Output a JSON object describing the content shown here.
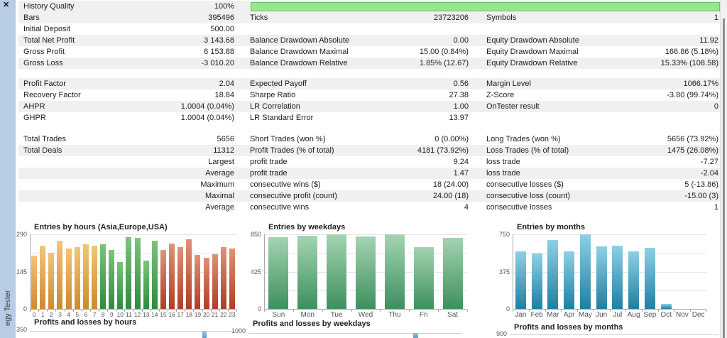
{
  "sidebar": {
    "close_glyph": "✕",
    "tab_label": "egy Tester"
  },
  "quality_bar": {
    "fill_color": "#98e78a",
    "border_color": "#6abf68"
  },
  "stats": {
    "rows": [
      {
        "l1": "History Quality",
        "v1": "100%",
        "progress": true,
        "shaded": true
      },
      {
        "l1": "Bars",
        "v1": "395496",
        "l2": "Ticks",
        "v2": "23723206",
        "l3": "Symbols",
        "v3": "1",
        "shaded": true
      },
      {
        "l1": "Initial Deposit",
        "v1": "500.00",
        "shaded": false
      },
      {
        "l1": "Total Net Profit",
        "v1": "3 143.68",
        "l2": "Balance Drawdown Absolute",
        "v2": "0.00",
        "l3": "Equity Drawdown Absolute",
        "v3": "11.92",
        "shaded": true
      },
      {
        "l1": "Gross Profit",
        "v1": "6 153.88",
        "l2": "Balance Drawdown Maximal",
        "v2": "15.00 (0.84%)",
        "l3": "Equity Drawdown Maximal",
        "v3": "166.86 (5.18%)",
        "shaded": false
      },
      {
        "l1": "Gross Loss",
        "v1": "-3 010.20",
        "l2": "Balance Drawdown Relative",
        "v2": "1.85% (12.67)",
        "l3": "Equity Drawdown Relative",
        "v3": "15.33% (108.58)",
        "shaded": true
      },
      {
        "l1": "Profit Factor",
        "v1": "2.04",
        "l2": "Expected Payoff",
        "v2": "0.56",
        "l3": "Margin Level",
        "v3": "1066.17%",
        "shaded": true
      },
      {
        "l1": "Recovery Factor",
        "v1": "18.84",
        "l2": "Sharpe Ratio",
        "v2": "27.38",
        "l3": "Z-Score",
        "v3": "-3.80 (99.74%)",
        "shaded": false
      },
      {
        "l1": "AHPR",
        "v1": "1.0004 (0.04%)",
        "l2": "LR Correlation",
        "v2": "1.00",
        "l3": "OnTester result",
        "v3": "0",
        "shaded": true
      },
      {
        "l1": "GHPR",
        "v1": "1.0004 (0.04%)",
        "l2": "LR Standard Error",
        "v2": "13.97",
        "shaded": false
      },
      {
        "l1": "Total Trades",
        "v1": "5656",
        "l2": "Short Trades (won %)",
        "v2": "0 (0.00%)",
        "l3": "Long Trades (won %)",
        "v3": "5656 (73.92%)",
        "shaded": false
      },
      {
        "l1": "Total Deals",
        "v1": "11312",
        "l2": "Profit Trades (% of total)",
        "v2": "4181 (73.92%)",
        "l3": "Loss Trades (% of total)",
        "v3": "1475 (26.08%)",
        "shaded": true
      },
      {
        "v1": "Largest",
        "l2": "profit trade",
        "v2": "9.24",
        "l3": "loss trade",
        "v3": "-7.27",
        "shaded": false
      },
      {
        "v1": "Average",
        "l2": "profit trade",
        "v2": "1.47",
        "l3": "loss trade",
        "v3": "-2.04",
        "shaded": true
      },
      {
        "v1": "Maximum",
        "l2": "consecutive wins ($)",
        "v2": "18 (24.00)",
        "l3": "consecutive losses ($)",
        "v3": "5 (-13.86)",
        "shaded": false
      },
      {
        "v1": "Maximal",
        "l2": "consecutive profit (count)",
        "v2": "24.00 (18)",
        "l3": "consecutive loss (count)",
        "v3": "-15.00 (3)",
        "shaded": true
      },
      {
        "v1": "Average",
        "l2": "consecutive wins",
        "v2": "4",
        "l3": "consecutive losses",
        "v3": "1",
        "shaded": false
      }
    ]
  },
  "chart_data": [
    {
      "type": "bar",
      "title": "Entries by hours (Asia,Europe,USA)",
      "categories": [
        "0",
        "1",
        "2",
        "3",
        "4",
        "5",
        "6",
        "7",
        "8",
        "9",
        "10",
        "11",
        "12",
        "13",
        "14",
        "15",
        "16",
        "17",
        "18",
        "19",
        "20",
        "21",
        "22",
        "23"
      ],
      "values": [
        208,
        246,
        219,
        266,
        235,
        239,
        252,
        246,
        252,
        230,
        182,
        279,
        277,
        187,
        266,
        230,
        255,
        239,
        272,
        210,
        199,
        213,
        239,
        235
      ],
      "ylim": [
        0,
        290
      ],
      "ytick_labels": [
        "0",
        "145",
        "290"
      ],
      "grid": true,
      "palette": [
        [
          "#f2c577",
          "#cc8a2e"
        ],
        [
          "#7cc47c",
          "#2e8b3e"
        ],
        [
          "#dc9478",
          "#af3d26"
        ]
      ],
      "bar_palette": [
        0,
        0,
        0,
        0,
        0,
        0,
        0,
        0,
        1,
        1,
        1,
        1,
        1,
        1,
        1,
        2,
        2,
        2,
        2,
        2,
        2,
        2,
        2,
        2
      ]
    },
    {
      "type": "bar",
      "title": "Entries by weekdays",
      "categories": [
        "Sun",
        "Mon",
        "Tue",
        "Wed",
        "Thu",
        "Fri",
        "Sat"
      ],
      "values": [
        815,
        833,
        850,
        828,
        847,
        705,
        808
      ],
      "ylim": [
        0,
        850
      ],
      "ytick_labels": [
        "0",
        "425",
        "850"
      ],
      "grid": true,
      "palette": [
        [
          "#a3d4b1",
          "#3e8f5e"
        ]
      ],
      "bar_palette": [
        0,
        0,
        0,
        0,
        0,
        0,
        0
      ]
    },
    {
      "type": "bar",
      "title": "Entries by months",
      "categories": [
        "Jan",
        "Feb",
        "Mar",
        "Apr",
        "May",
        "Jun",
        "Jul",
        "Aug",
        "Sep",
        "Oct",
        "Nov",
        "Dec"
      ],
      "values": [
        578,
        554,
        696,
        582,
        748,
        632,
        637,
        578,
        613,
        47,
        0,
        0
      ],
      "ylim": [
        0,
        750
      ],
      "ytick_labels": [
        "0",
        "375",
        "750"
      ],
      "grid": true,
      "palette": [
        [
          "#8ed0e4",
          "#1f7fa4"
        ]
      ],
      "bar_palette": [
        0,
        0,
        0,
        0,
        0,
        0,
        0,
        0,
        0,
        0,
        0,
        0
      ]
    },
    {
      "type": "bar",
      "title": "Profits and losses by hours",
      "partial": true,
      "ymax_label": "350",
      "n_slots": 24,
      "visible_bar_index": 20,
      "bar_color": "#5b9fd0"
    },
    {
      "type": "bar",
      "title": "Profits and losses by weekdays",
      "partial": true,
      "ymax_label": "1000",
      "n_slots": 7,
      "visible_bar_index": 5,
      "bar_color": "#5b9fd0"
    },
    {
      "type": "bar",
      "title": "Profits and losses by months",
      "partial": true,
      "ymax_label": "900",
      "n_slots": 12
    }
  ]
}
